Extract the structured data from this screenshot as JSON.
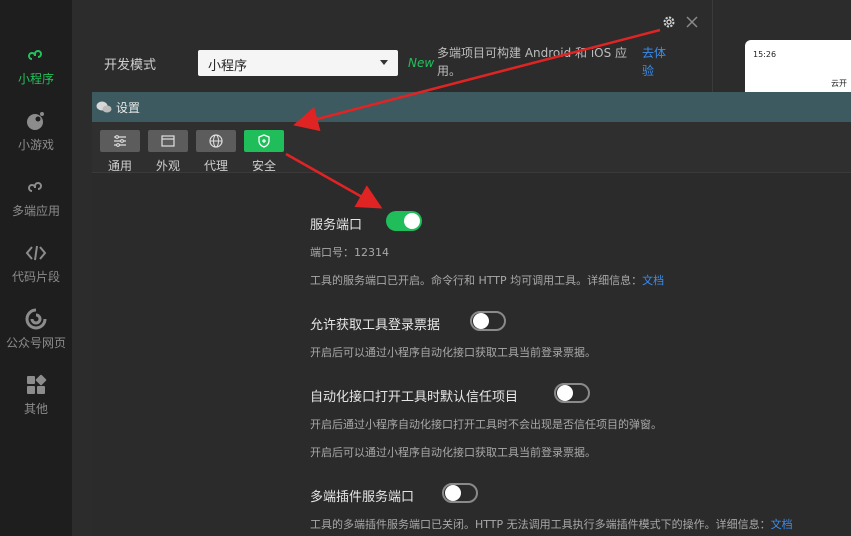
{
  "sidebar": {
    "items": [
      {
        "label": "小程序",
        "icon": "miniprogram-icon",
        "active": true
      },
      {
        "label": "小游戏",
        "icon": "minigame-icon",
        "active": false
      },
      {
        "label": "多端应用",
        "icon": "multiplatform-icon",
        "active": false
      },
      {
        "label": "代码片段",
        "icon": "code-snippet-icon",
        "active": false
      },
      {
        "label": "公众号网页",
        "icon": "official-account-icon",
        "active": false
      },
      {
        "label": "其他",
        "icon": "other-icon",
        "active": false
      }
    ]
  },
  "base": {
    "dev_mode_label": "开发模式",
    "dev_mode_value": "小程序",
    "new_badge": "New",
    "desc": "多端项目可构建 Android 和 iOS 应用。",
    "try_link": "去体验",
    "phone_time": "15:26",
    "phone_text": "云开"
  },
  "dialog": {
    "title": "设置",
    "tabs": [
      {
        "label": "通用",
        "icon": "sliders-icon"
      },
      {
        "label": "外观",
        "icon": "window-icon"
      },
      {
        "label": "代理",
        "icon": "globe-icon"
      },
      {
        "label": "安全",
        "icon": "shield-icon"
      }
    ],
    "settings": {
      "service_port": {
        "title": "服务端口",
        "port_label": "端口号：12314",
        "desc": "工具的服务端口已开启。命令行和 HTTP 均可调用工具。详细信息：",
        "link": "文档"
      },
      "allow_ticket": {
        "title": "允许获取工具登录票据",
        "desc": "开启后可以通过小程序自动化接口获取工具当前登录票据。"
      },
      "auto_trust": {
        "title": "自动化接口打开工具时默认信任项目",
        "desc1": "开启后通过小程序自动化接口打开工具时不会出现是否信任项目的弹窗。",
        "desc2": "开启后可以通过小程序自动化接口获取工具当前登录票据。"
      },
      "plugin_port": {
        "title": "多端插件服务端口",
        "desc": "工具的多端插件服务端口已关闭。HTTP 无法调用工具执行多端插件模式下的操作。详细信息：",
        "link": "文档"
      }
    }
  },
  "colors": {
    "accent": "#1fbe5a",
    "link": "#3a8ef0",
    "arrow": "#e02424",
    "titlebar": "#3c5a5f"
  }
}
